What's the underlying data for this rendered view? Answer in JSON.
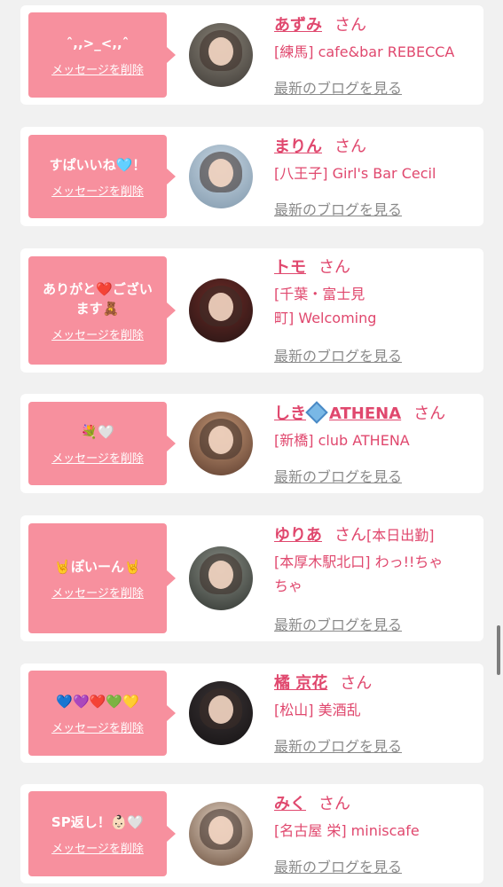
{
  "common": {
    "delete_label": "メッセージを削除",
    "san": "さん",
    "blog_label": "最新のブログを見る"
  },
  "messages": [
    {
      "text": "ˆ,,>_<,,ˆ",
      "name": "あずみ",
      "status": "",
      "shop": "[練馬] cafe&bar REBECCA",
      "avatar_colors": [
        "#8a8478",
        "#3e3a36"
      ]
    },
    {
      "text": "すぱいいね🩵！",
      "name": "まりん",
      "status": "",
      "shop": "[八王子] Girl's Bar Cecil",
      "avatar_colors": [
        "#c9d8e4",
        "#7f97ab"
      ]
    },
    {
      "text": "ありがと❤️ござい\nます🧸",
      "name": "トモ",
      "status": "",
      "shop": "[千葉・富士見\n町] Welcoming",
      "avatar_colors": [
        "#6e2a26",
        "#241514"
      ]
    },
    {
      "text": "💐🤍",
      "name_pre": "しき",
      "name_post": "ATHENA",
      "name_gem_icon": "diamond-icon",
      "status": "",
      "shop": "[新橋] club ATHENA",
      "avatar_colors": [
        "#c79a78",
        "#5a3a2c"
      ]
    },
    {
      "text": "🤘ぽいーん🤘",
      "name": "ゆりあ",
      "status": "[本日出勤]",
      "shop": "[本厚木駅北口] わっ!!ちゃ\nちゃ",
      "avatar_colors": [
        "#8a8f86",
        "#2f332f"
      ]
    },
    {
      "text": "💙💜❤️💚💛",
      "name": "橘 京花",
      "status": "",
      "shop": "[松山] 美酒乱",
      "avatar_colors": [
        "#3a3436",
        "#151213"
      ]
    },
    {
      "text": "SP返し！👶🏻🤍",
      "name": "みく",
      "status": "",
      "shop": "[名古屋 栄] miniscafe",
      "avatar_colors": [
        "#e3d3c4",
        "#6b4f3c"
      ]
    }
  ]
}
